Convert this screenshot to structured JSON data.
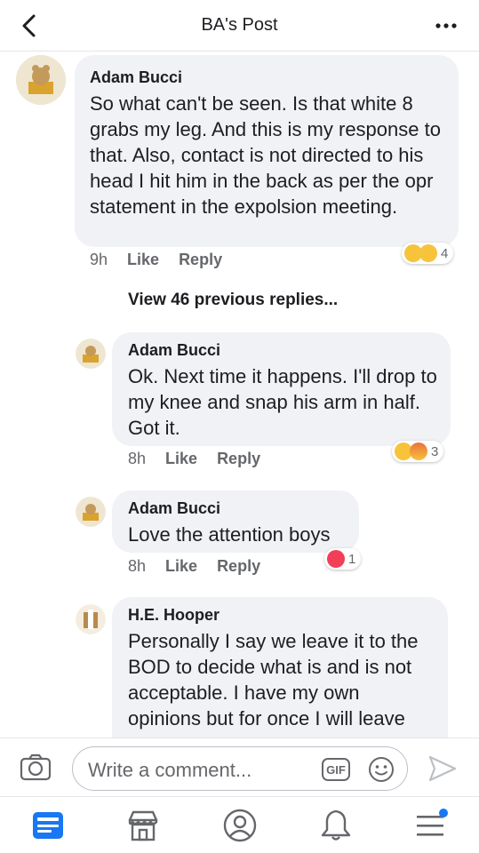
{
  "header": {
    "title": "BA's Post",
    "back_icon": "back-chevron-icon",
    "more_icon": "more-dots-icon"
  },
  "comments": [
    {
      "author": "Adam Bucci",
      "text": "So what can't be seen. Is that white 8 grabs my leg. And this is my response to that. Also, contact is not directed to his head I hit him in the back as per the opr statement in the expolsion meeting.",
      "time": "9h",
      "like": "Like",
      "reply": "Reply",
      "reactions": [
        "haha",
        "wow"
      ],
      "reaction_count": "4"
    }
  ],
  "view_previous": "View 46 previous replies...",
  "replies": [
    {
      "author": "Adam Bucci",
      "text": "Ok. Next time it happens. I'll drop to my knee and snap his arm in half. Got it.",
      "time": "8h",
      "like": "Like",
      "reply": "Reply",
      "reactions": [
        "wow",
        "angry"
      ],
      "reaction_count": "3"
    },
    {
      "author": "Adam Bucci",
      "text": "Love the attention boys",
      "time": "8h",
      "like": "Like",
      "reply": "Reply",
      "reactions": [
        "love"
      ],
      "reaction_count": "1"
    },
    {
      "author": "H.E. Hooper",
      "text": "Personally I say we leave it to the BOD to decide what is and is not acceptable. I have my own opinions but for once I will leave"
    }
  ],
  "composer": {
    "placeholder": "Write a comment...",
    "gif_label": "GIF"
  },
  "nav": {
    "items": [
      "feed-icon",
      "marketplace-icon",
      "profile-icon",
      "notifications-icon",
      "menu-icon"
    ]
  },
  "colors": {
    "bubble": "#f0f2f5",
    "text": "#1c1e21",
    "meta": "#65676b",
    "accent": "#1877f2",
    "love": "#f33e58",
    "haha": "#f7c33b"
  }
}
